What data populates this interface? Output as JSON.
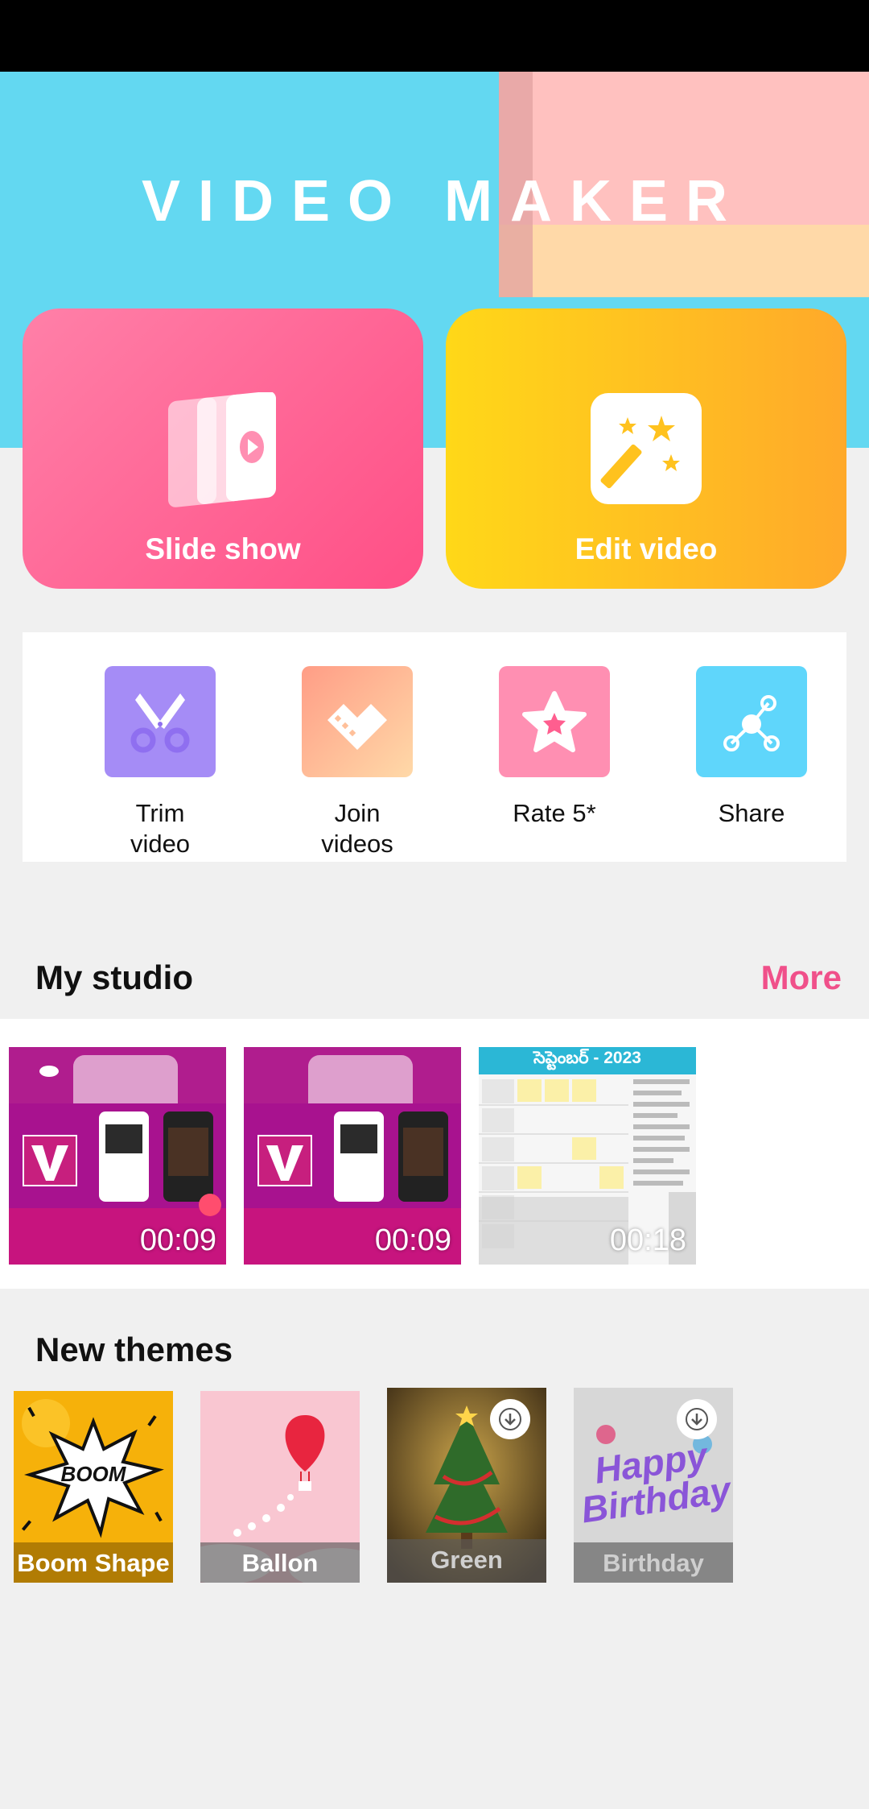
{
  "header": {
    "title": "VIDEO MAKER"
  },
  "main_actions": [
    {
      "label": "Slide show",
      "icon": "slideshow-icon"
    },
    {
      "label": "Edit video",
      "icon": "magic-wand-icon"
    }
  ],
  "tools": [
    {
      "label": "Trim\nvideo",
      "icon": "scissors-icon",
      "color": "#a58cf6"
    },
    {
      "label": "Join\nvideos",
      "icon": "film-heart-icon",
      "color": "#ffb78c"
    },
    {
      "label": "Rate 5*",
      "icon": "star-icon",
      "color": "#ff8fb2"
    },
    {
      "label": "Share",
      "icon": "share-icon",
      "color": "#5fd6fb"
    }
  ],
  "studio": {
    "title": "My studio",
    "more_label": "More",
    "videos": [
      {
        "duration": "00:09"
      },
      {
        "duration": "00:09"
      },
      {
        "duration": "00:18",
        "calendar_title": "సెప్టెంబర్ - 2023"
      }
    ]
  },
  "themes": {
    "title": "New themes",
    "items": [
      {
        "name": "Boom Shape",
        "art_text": "BOOM",
        "downloaded": true
      },
      {
        "name": "Ballon",
        "downloaded": true
      },
      {
        "name": "Green",
        "downloaded": false
      },
      {
        "name": "Birthday",
        "art_text": "Happy Birthday",
        "downloaded": false
      }
    ]
  },
  "colors": {
    "accent": "#f0508a",
    "header_bg": "#63d8f1"
  }
}
